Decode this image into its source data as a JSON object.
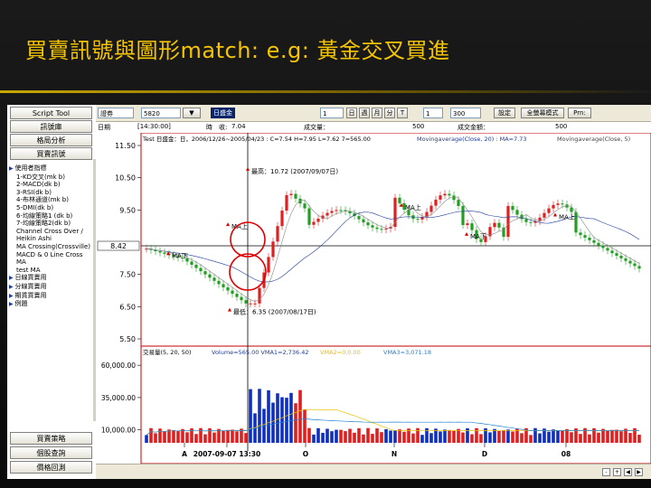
{
  "slide": {
    "title": "買賣訊號與圖形match: e.g: 黃金交叉買進"
  },
  "left_panel": {
    "top_buttons": [
      "Script Tool",
      "訊號庫",
      "格局分析",
      "買賣訊號"
    ],
    "items": [
      {
        "label": "使用者指標",
        "folder": true
      },
      {
        "label": "1-KD交叉(mk b)"
      },
      {
        "label": "2-MACD(dk b)"
      },
      {
        "label": "3-RSI(dk b)"
      },
      {
        "label": "4-布林通道(mk b)"
      },
      {
        "label": "5-DMI(dk b)"
      },
      {
        "label": "6-均線策略1 (dk b)"
      },
      {
        "label": "7-均線策略2(dk b)"
      },
      {
        "label": "Channel Cross Over /"
      },
      {
        "label": "Heikin Ashi"
      },
      {
        "label": "MA Crossing(Crossville)"
      },
      {
        "label": "MACD & 0 Line Cross"
      },
      {
        "label": "MA"
      },
      {
        "label": "test MA"
      },
      {
        "label": "日線買賣用",
        "folder": true
      },
      {
        "label": "分線買賣用",
        "folder": true
      },
      {
        "label": "期貨買賣用",
        "folder": true
      },
      {
        "label": "例題",
        "folder": true
      }
    ],
    "bottom_buttons": [
      "買賣策略",
      "個股查詢",
      "價格回測"
    ]
  },
  "toolbar": {
    "market": "證券",
    "code": "5820",
    "name": "日盛金",
    "period_count": "1",
    "day": "日",
    "week": "週",
    "month": "月",
    "minute": "分",
    "tick": "T",
    "count1": "1",
    "count2": "300",
    "settings": "設定",
    "full_screen": "全螢幕模式",
    "print": "Prn:"
  },
  "sub_toolbar": {
    "label1": "日期",
    "date": "[14:30:00]",
    "label2": "時",
    "price_label": "收:",
    "price": "7.04",
    "volume_label": "成交量：",
    "volume": "500",
    "amount_label": "成交金額：",
    "amount": "500"
  },
  "colors": {
    "up": "#e02020",
    "down": "#20a020",
    "ma20": "#2050c0",
    "ma5": "#808080",
    "marker": "#e00000"
  },
  "chart_data": {
    "type": "candlestick",
    "legend": {
      "ohlc": "Test   日盛金：日，2006/12/26~2005/04/23 : C=7.54 H=7.95 L=7.62 7=565.00",
      "ma20": "Movingaverage(Close, 20) : MA=7.73",
      "ma5": "Movingaverage(Close, 5)"
    },
    "y_axis": {
      "ticks": [
        "11.50",
        "10.50",
        "9.50",
        "8.42",
        "7.50",
        "6.50",
        "5.50"
      ],
      "range": [
        5.5,
        11.5
      ]
    },
    "current_price": "8.42",
    "annotations": [
      {
        "text": "最高：10.72 (2007/09/07日)",
        "value": 10.72
      },
      {
        "text": "最低：6.35 (2007/08/17日)",
        "value": 6.35
      },
      {
        "text": "MA上",
        "value": 9.0
      },
      {
        "text": "MA下",
        "value": 8.1
      },
      {
        "text": "MA上",
        "value": 9.6
      },
      {
        "text": "MA下",
        "value": 8.7
      },
      {
        "text": "MA上",
        "value": 9.3
      }
    ],
    "volume_panel": {
      "legend_a": "交易量(5, 20, 50)",
      "legend_b": "Volume=565.00 VMA1=2,736.42",
      "legend_c": "VMA2=0,0.00",
      "legend_d": "VMA3=3,071.18",
      "y_ticks": [
        "60,000.00",
        "35,000.00",
        "10,000.00"
      ],
      "range": [
        0,
        65000
      ]
    },
    "x_axis": {
      "ticks": [
        "A",
        "2007-09-07 13:30",
        "O",
        "N",
        "D",
        "08"
      ]
    }
  }
}
